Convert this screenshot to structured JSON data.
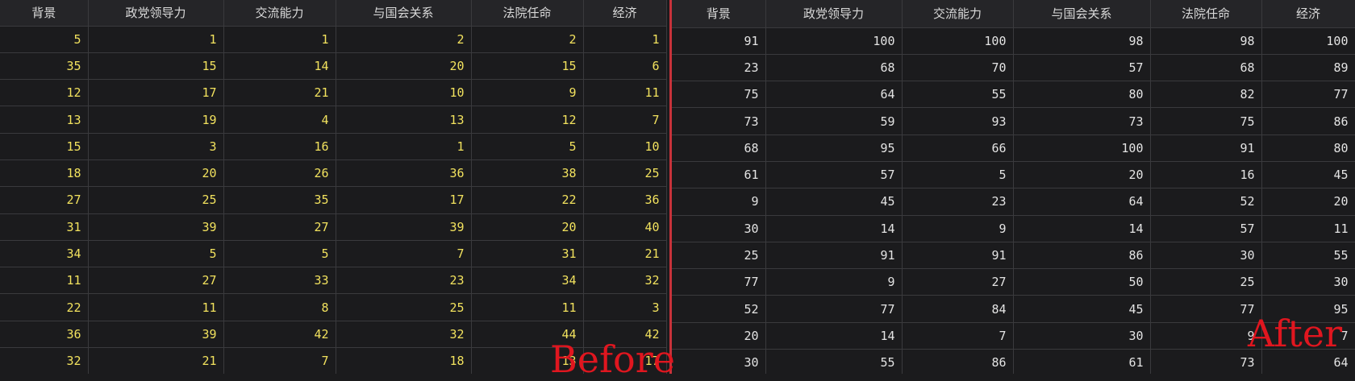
{
  "before": {
    "headers": [
      "背景",
      "政党领导力",
      "交流能力",
      "与国会关系",
      "法院任命",
      "经济"
    ],
    "rows": [
      [
        "5",
        "1",
        "1",
        "2",
        "2",
        "1"
      ],
      [
        "35",
        "15",
        "14",
        "20",
        "15",
        "6"
      ],
      [
        "12",
        "17",
        "21",
        "10",
        "9",
        "11"
      ],
      [
        "13",
        "19",
        "4",
        "13",
        "12",
        "7"
      ],
      [
        "15",
        "3",
        "16",
        "1",
        "5",
        "10"
      ],
      [
        "18",
        "20",
        "26",
        "36",
        "38",
        "25"
      ],
      [
        "27",
        "25",
        "35",
        "17",
        "22",
        "36"
      ],
      [
        "31",
        "39",
        "27",
        "39",
        "20",
        "40"
      ],
      [
        "34",
        "5",
        "5",
        "7",
        "31",
        "21"
      ],
      [
        "11",
        "27",
        "33",
        "23",
        "34",
        "32"
      ],
      [
        "22",
        "11",
        "8",
        "25",
        "11",
        "3"
      ],
      [
        "36",
        "39",
        "42",
        "32",
        "44",
        "42"
      ],
      [
        "32",
        "21",
        "7",
        "18",
        "13",
        "17"
      ]
    ]
  },
  "after": {
    "headers": [
      "背景",
      "政党领导力",
      "交流能力",
      "与国会关系",
      "法院任命",
      "经济"
    ],
    "rows": [
      [
        "91",
        "100",
        "100",
        "98",
        "98",
        "100"
      ],
      [
        "23",
        "68",
        "70",
        "57",
        "68",
        "89"
      ],
      [
        "75",
        "64",
        "55",
        "80",
        "82",
        "77"
      ],
      [
        "73",
        "59",
        "93",
        "73",
        "75",
        "86"
      ],
      [
        "68",
        "95",
        "66",
        "100",
        "91",
        "80"
      ],
      [
        "61",
        "57",
        "5",
        "20",
        "16",
        "45"
      ],
      [
        "9",
        "45",
        "23",
        "64",
        "52",
        "20"
      ],
      [
        "30",
        "14",
        "9",
        "14",
        "57",
        "11"
      ],
      [
        "25",
        "91",
        "91",
        "86",
        "30",
        "55"
      ],
      [
        "77",
        "9",
        "27",
        "50",
        "25",
        "30"
      ],
      [
        "52",
        "77",
        "84",
        "45",
        "77",
        "95"
      ],
      [
        "20",
        "14",
        "7",
        "30",
        "9",
        "7"
      ],
      [
        "30",
        "55",
        "86",
        "61",
        "73",
        "64"
      ]
    ]
  },
  "labels": {
    "before": "Before",
    "after": "After"
  },
  "colors": {
    "before_values": "#f2e25e",
    "after_values": "#e4e4e4",
    "divider": "#c8323a",
    "label": "#e0161f",
    "background": "#1b1b1d",
    "header_bg": "#252528"
  }
}
